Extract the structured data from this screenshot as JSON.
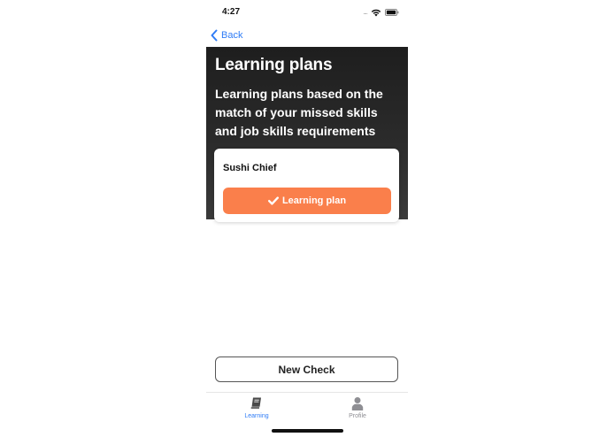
{
  "status_bar": {
    "time": "4:27",
    "signal": "....",
    "icons": [
      "wifi-icon",
      "battery-icon"
    ]
  },
  "nav": {
    "back_label": "Back",
    "back_icon": "chevron-left-icon"
  },
  "hero": {
    "title": "Learning plans",
    "subtitle": "Learning plans based on the match of your missed skills and job skills requirements"
  },
  "plan_card": {
    "name": "Sushi Chief",
    "button_label": "Learning plan",
    "button_icon": "check-icon"
  },
  "actions": {
    "new_check_label": "New Check"
  },
  "tab_bar": {
    "items": [
      {
        "label": "Learning",
        "icon": "book-icon",
        "active": true
      },
      {
        "label": "Profile",
        "icon": "user-icon",
        "active": false
      }
    ]
  },
  "colors": {
    "accent_blue": "#2f7cf6",
    "accent_orange": "#fa7f4b",
    "hero_dark": "#242424",
    "inactive_gray": "#8e8e93"
  }
}
